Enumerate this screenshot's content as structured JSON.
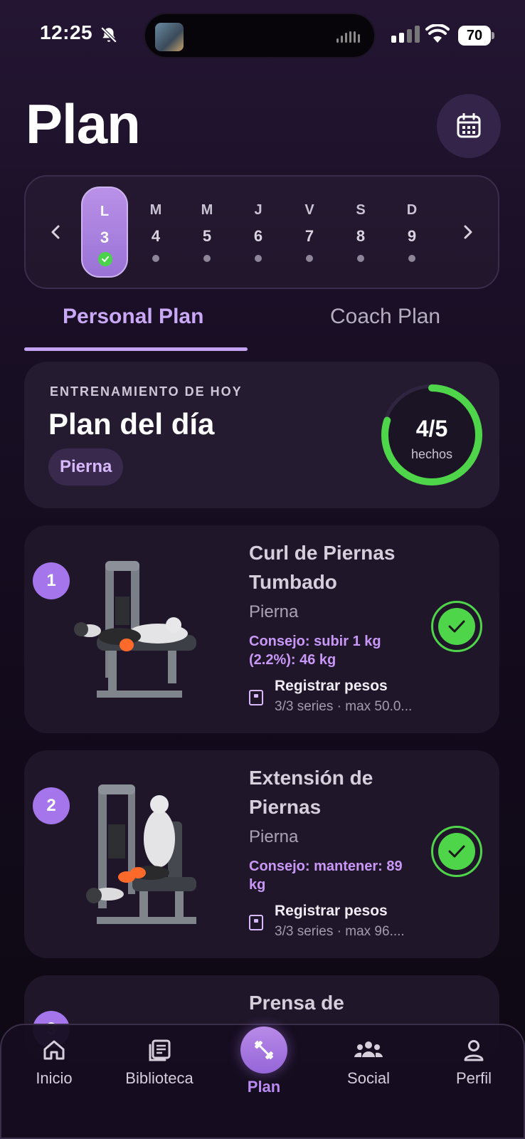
{
  "status_bar": {
    "time": "12:25",
    "battery": "70"
  },
  "header": {
    "title": "Plan"
  },
  "week": {
    "days": [
      {
        "letter": "L",
        "number": "3"
      },
      {
        "letter": "M",
        "number": "4"
      },
      {
        "letter": "M",
        "number": "5"
      },
      {
        "letter": "J",
        "number": "6"
      },
      {
        "letter": "V",
        "number": "7"
      },
      {
        "letter": "S",
        "number": "8"
      },
      {
        "letter": "D",
        "number": "9"
      }
    ]
  },
  "tabs": {
    "personal": "Personal Plan",
    "coach": "Coach Plan"
  },
  "today": {
    "overline": "ENTRENAMIENTO DE HOY",
    "title": "Plan del día",
    "tag": "Pierna",
    "progress_value": "4/5",
    "progress_label": "hechos",
    "progress_fraction": 0.8
  },
  "exercises": [
    {
      "number": "1",
      "name": "Curl de Piernas Tumbado",
      "category": "Pierna",
      "tip": "Consejo: subir 1 kg (2.2%): 46 kg",
      "log_title": "Registrar pesos",
      "log_sub": "3/3 series · max 50.0..."
    },
    {
      "number": "2",
      "name": "Extensión de Piernas",
      "category": "Pierna",
      "tip": "Consejo: mantener: 89 kg",
      "log_title": "Registrar pesos",
      "log_sub": "3/3 series · max 96...."
    },
    {
      "number": "3",
      "name": "Prensa de"
    }
  ],
  "nav": {
    "inicio": "Inicio",
    "biblioteca": "Biblioteca",
    "plan": "Plan",
    "social": "Social",
    "perfil": "Perfil"
  },
  "colors": {
    "accent": "#b98af0",
    "success": "#4fd54a",
    "background": "#1a0f26"
  }
}
